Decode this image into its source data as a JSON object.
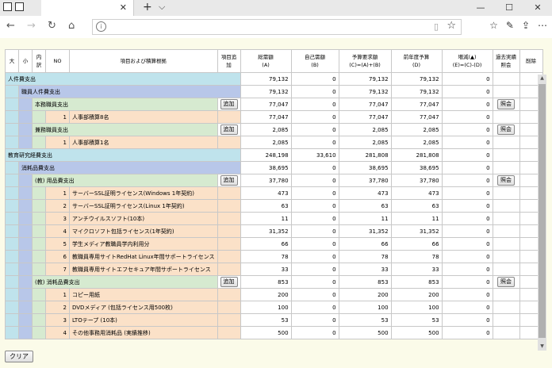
{
  "browser": {
    "plus": "+",
    "chevron": "⌵",
    "back": "←",
    "forward": "→",
    "refresh": "↻",
    "home": "⌂",
    "close_tab": "✕",
    "minimize": "—",
    "maximize": "☐",
    "close": "✕"
  },
  "header": {
    "dai": "大",
    "sho": "小",
    "uchi": "内訳",
    "no": "NO",
    "item": "項目および積算根拠",
    "add": "項目追加",
    "total": "総需額",
    "total_sub": "(A)",
    "self": "自己需額",
    "self_sub": "(B)",
    "request": "予算要求額",
    "request_sub": "(C)=(A)+(B)",
    "prev": "前年度予算",
    "prev_sub": "(D)",
    "diff": "増減(▲)",
    "diff_sub": "(E)=(C)-(D)",
    "past": "過去実績照会",
    "del": "削除"
  },
  "buttons": {
    "add": "追加",
    "ref": "照会",
    "clear": "クリア"
  },
  "rows": [
    {
      "level": 1,
      "label": "人件費支出",
      "total": "79,132",
      "self": "0",
      "request": "79,132",
      "prev": "79,132",
      "diff": "0"
    },
    {
      "level": 2,
      "label": "職員人件費支出",
      "total": "79,132",
      "self": "0",
      "request": "79,132",
      "prev": "79,132",
      "diff": "0"
    },
    {
      "level": 3,
      "label": "本務職員支出",
      "add": true,
      "ref": true,
      "total": "77,047",
      "self": "0",
      "request": "77,047",
      "prev": "77,047",
      "diff": "0"
    },
    {
      "level": 4,
      "no": "1",
      "label": "人事部積算8名",
      "total": "77,047",
      "self": "0",
      "request": "77,047",
      "prev": "77,047",
      "diff": "0"
    },
    {
      "level": 3,
      "label": "兼務職員支出",
      "add": true,
      "ref": true,
      "total": "2,085",
      "self": "0",
      "request": "2,085",
      "prev": "2,085",
      "diff": "0"
    },
    {
      "level": 4,
      "no": "1",
      "label": "人事部積算1名",
      "total": "2,085",
      "self": "0",
      "request": "2,085",
      "prev": "2,085",
      "diff": "0"
    },
    {
      "level": 1,
      "label": "教育研究経費支出",
      "total": "248,198",
      "self": "33,610",
      "request": "281,808",
      "prev": "281,808",
      "diff": "0"
    },
    {
      "level": 2,
      "label": "消耗品費支出",
      "total": "38,695",
      "self": "0",
      "request": "38,695",
      "prev": "38,695",
      "diff": "0"
    },
    {
      "level": 3,
      "label": "(教) 用品費支出",
      "add": true,
      "ref": true,
      "total": "37,780",
      "self": "0",
      "request": "37,780",
      "prev": "37,780",
      "diff": "0"
    },
    {
      "level": 4,
      "no": "1",
      "label": "サーバーSSL証明ライセンス(Windows 1年契約)",
      "total": "473",
      "self": "0",
      "request": "473",
      "prev": "473",
      "diff": "0"
    },
    {
      "level": 4,
      "no": "2",
      "label": "サーバーSSL証明ライセンス(Linux 1年契約)",
      "total": "63",
      "self": "0",
      "request": "63",
      "prev": "63",
      "diff": "0"
    },
    {
      "level": 4,
      "no": "3",
      "label": "アンチウイルスソフト(10本)",
      "total": "11",
      "self": "0",
      "request": "11",
      "prev": "11",
      "diff": "0"
    },
    {
      "level": 4,
      "no": "4",
      "label": "マイクロソフト包括ライセンス(1年契約)",
      "total": "31,352",
      "self": "0",
      "request": "31,352",
      "prev": "31,352",
      "diff": "0"
    },
    {
      "level": 4,
      "no": "5",
      "label": "学生メディア教職員学内利用分",
      "total": "66",
      "self": "0",
      "request": "66",
      "prev": "66",
      "diff": "0"
    },
    {
      "level": 4,
      "no": "6",
      "label": "教職員専用サイトRedHat Linux年間サポートライセンス",
      "total": "78",
      "self": "0",
      "request": "78",
      "prev": "78",
      "diff": "0"
    },
    {
      "level": 4,
      "no": "7",
      "label": "教職員専用サイトエフセキュア年間サポートライセンス",
      "total": "33",
      "self": "0",
      "request": "33",
      "prev": "33",
      "diff": "0"
    },
    {
      "level": 3,
      "label": "(教) 消耗品費支出",
      "add": true,
      "ref": true,
      "total": "853",
      "self": "0",
      "request": "853",
      "prev": "853",
      "diff": "0"
    },
    {
      "level": 4,
      "no": "1",
      "label": "コピー用紙",
      "total": "200",
      "self": "0",
      "request": "200",
      "prev": "200",
      "diff": "0"
    },
    {
      "level": 4,
      "no": "2",
      "label": "DVDメディア (包括ライセンス用500枚)",
      "total": "100",
      "self": "0",
      "request": "100",
      "prev": "100",
      "diff": "0"
    },
    {
      "level": 4,
      "no": "3",
      "label": "LTOテープ (10本)",
      "total": "53",
      "self": "0",
      "request": "53",
      "prev": "53",
      "diff": "0"
    },
    {
      "level": 4,
      "no": "4",
      "label": "その他事務用消耗品 (実績推移)",
      "total": "500",
      "self": "0",
      "request": "500",
      "prev": "500",
      "diff": "0"
    }
  ]
}
